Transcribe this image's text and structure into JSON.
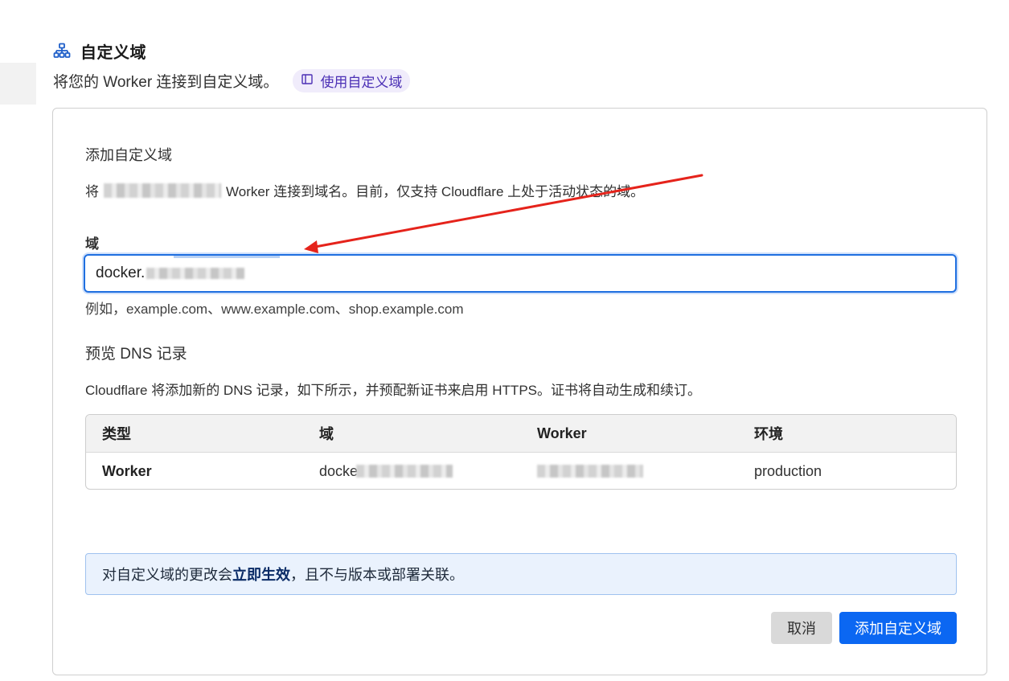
{
  "section": {
    "title": "自定义域",
    "description": "将您的 Worker 连接到自定义域。",
    "docs_link": "使用自定义域"
  },
  "card": {
    "heading": "添加自定义域",
    "desc_prefix": "将",
    "desc_suffix": "Worker 连接到域名。目前，仅支持 Cloudflare 上处于活动状态的域。"
  },
  "domain_field": {
    "label": "域",
    "value_visible": "docker.",
    "hint": "例如，example.com、www.example.com、shop.example.com"
  },
  "preview": {
    "heading": "预览 DNS 记录",
    "description": "Cloudflare 将添加新的 DNS 记录，如下所示，并预配新证书来启用 HTTPS。证书将自动生成和续订。"
  },
  "dns_table": {
    "columns": [
      "类型",
      "域",
      "Worker",
      "环境"
    ],
    "rows": [
      {
        "type": "Worker",
        "domain_visible": "docke",
        "environment": "production"
      }
    ]
  },
  "banner": {
    "prefix": "对自定义域的更改会",
    "bold": "立即生效",
    "suffix": "，且不与版本或部署关联。"
  },
  "buttons": {
    "cancel": "取消",
    "add": "添加自定义域"
  },
  "colors": {
    "primary": "#0b67f2",
    "focus_border": "#1f6fe0",
    "banner_bg": "#eaf2fd",
    "pill_bg": "#f0ecfb",
    "annotation_arrow": "#e5231b"
  },
  "icons": {
    "section": "sitemap-icon",
    "docs": "book-icon"
  }
}
